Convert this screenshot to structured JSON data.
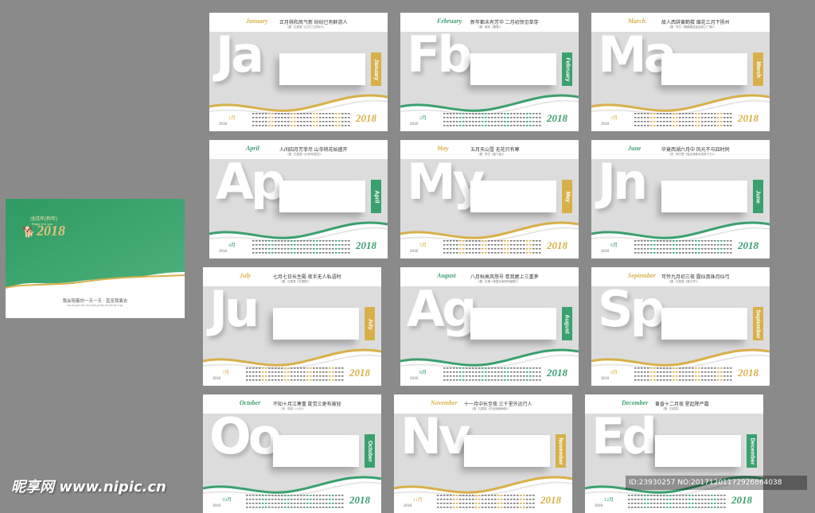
{
  "colors": {
    "background": "#8a8a8a",
    "green": "#3aa06e",
    "gold": "#d8b04a"
  },
  "cover": {
    "title": "戊戌年(狗年)",
    "subtitle": "Happy new year",
    "year_logo": "2018",
    "tagline": "我会陪着你一天一天 · 直至我离去",
    "tagline_sub": "wo hui pei zhe ni yi tian yi tian zhi zhi wo li qu"
  },
  "months": [
    {
      "en": "January",
      "abbr": "Ja",
      "poem": "正月桃和风气新  纷纷已有醉游人",
      "poem_source": "（唐 · 白居易《正月三日闲行》）",
      "num": "1月",
      "year": "2018",
      "accent": "gold",
      "logo": "2018"
    },
    {
      "en": "February",
      "abbr": "Fb",
      "poem": "新年都未有芳华  二月初惊见草芽",
      "poem_source": "（唐 · 韩愈《春雪》）",
      "num": "2月",
      "year": "2018",
      "accent": "green",
      "logo": "2018"
    },
    {
      "en": "March",
      "abbr": "Ma",
      "poem": "故人西辞黄鹤楼  烟花三月下扬州",
      "poem_source": "（唐 · 李白《黄鹤楼送孟浩然之广陵》）",
      "num": "3月",
      "year": "2018",
      "accent": "gold",
      "logo": "2018"
    },
    {
      "en": "April",
      "abbr": "Ap",
      "poem": "人间四月芳菲尽  山寺桃花始盛开",
      "poem_source": "（唐 · 白居易《大林寺桃花》）",
      "num": "4月",
      "year": "2018",
      "accent": "green",
      "logo": "2018"
    },
    {
      "en": "May",
      "abbr": "My",
      "poem": "五月天山雪  无花只有寒",
      "poem_source": "（唐 · 李白《塞下曲》）",
      "num": "5月",
      "year": "2018",
      "accent": "gold",
      "logo": "2018"
    },
    {
      "en": "June",
      "abbr": "Jn",
      "poem": "毕竟西湖六月中  风光不与四时同",
      "poem_source": "（宋 · 杨万里《晓出净慈寺送林子方》）",
      "num": "6月",
      "year": "2018",
      "accent": "green",
      "logo": "2018"
    },
    {
      "en": "July",
      "abbr": "Ju",
      "poem": "七月七日长生殿  夜半无人私语时",
      "poem_source": "（唐 · 白居易《长恨歌》）",
      "num": "7月",
      "year": "2018",
      "accent": "gold",
      "logo": "2018"
    },
    {
      "en": "August",
      "abbr": "Ag",
      "poem": "八月秋高风怒号  卷我屋上三重茅",
      "poem_source": "（唐 · 杜甫《茅屋为秋风所破歌》）",
      "num": "8月",
      "year": "2018",
      "accent": "green",
      "logo": "2018"
    },
    {
      "en": "September",
      "abbr": "Sp",
      "poem": "可怜九月初三夜  露似真珠月似弓",
      "poem_source": "（唐 · 白居易《暮江吟》）",
      "num": "9月",
      "year": "2018",
      "accent": "gold",
      "logo": "2018"
    },
    {
      "en": "October",
      "abbr": "Oo",
      "poem": "不知十月江寒重  陡觉三更布被轻",
      "poem_source": "（宋 · 陆游《十月》）",
      "num": "10月",
      "year": "2018",
      "accent": "green",
      "logo": "2018"
    },
    {
      "en": "November",
      "abbr": "Nv",
      "poem": "十一月中长至夜  三千里外远行人",
      "poem_source": "（唐 · 白居易《冬至宿杨梅馆》）",
      "num": "11月",
      "year": "2018",
      "accent": "gold",
      "logo": "2018"
    },
    {
      "en": "December",
      "abbr": "Ed",
      "poem": "黄昏十二月夜  星起降严霜",
      "poem_source": "（唐 · 白居易）",
      "num": "12月",
      "year": "2018",
      "accent": "green",
      "logo": "2018"
    }
  ],
  "watermark": "昵享网 www.nipic.cn",
  "image_id": "ID:23930257 NO:20171201172926864038"
}
